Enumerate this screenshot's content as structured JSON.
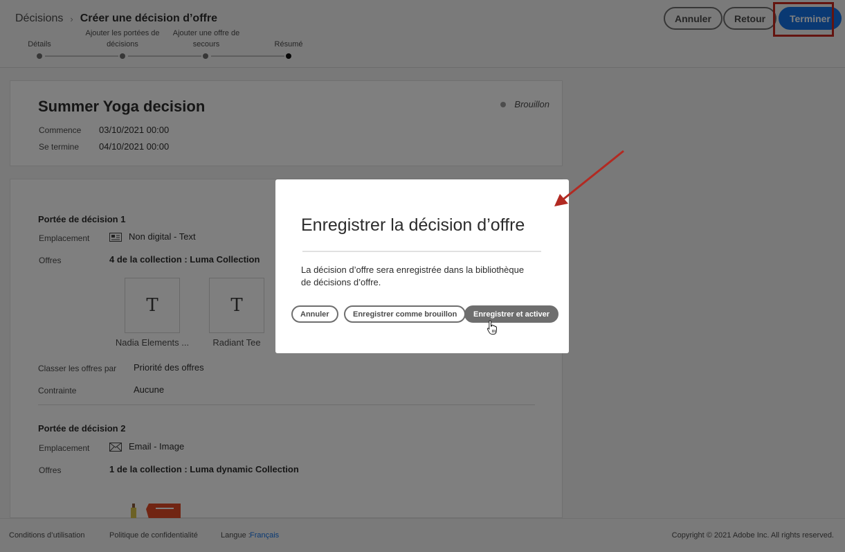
{
  "header": {
    "breadcrumb_root": "Décisions",
    "breadcrumb_sep": "›",
    "breadcrumb_current": "Créer une décision d’offre",
    "steps": [
      {
        "label": "Détails"
      },
      {
        "label": "Ajouter les portées de décisions"
      },
      {
        "label": "Ajouter une offre de secours"
      },
      {
        "label": "Résumé"
      }
    ],
    "cancel_label": "Annuler",
    "back_label": "Retour",
    "finish_label": "Terminer"
  },
  "summary": {
    "title": "Summer Yoga decision",
    "status": "Brouillon",
    "start_label": "Commence",
    "start_value": "03/10/2021 00:00",
    "end_label": "Se termine",
    "end_value": "04/10/2021 00:00"
  },
  "scope1": {
    "title": "Portée de décision 1",
    "placement_label": "Emplacement",
    "placement_value": "Non digital - Text",
    "offers_label": "Offres",
    "offers_value": "4 de la collection : Luma Collection",
    "offers": [
      {
        "glyph": "T",
        "name": "Nadia Elements ..."
      },
      {
        "glyph": "T",
        "name": "Radiant Tee"
      }
    ],
    "rank_label": "Classer les offres par",
    "rank_value": "Priorité des offres",
    "constraint_label": "Contrainte",
    "constraint_value": "Aucune"
  },
  "scope2": {
    "title": "Portée de décision 2",
    "placement_label": "Emplacement",
    "placement_value": "Email - Image",
    "offers_label": "Offres",
    "offers_value": "1 de la collection : Luma dynamic Collection"
  },
  "footer": {
    "terms": "Conditions d’utilisation",
    "privacy": "Politique de confidentialité",
    "language_label": "Langue :",
    "language_value": "Français",
    "copyright": "Copyright  ©  2021 Adobe Inc.  All rights reserved."
  },
  "modal": {
    "title": "Enregistrer la décision d’offre",
    "body": "La décision d’offre sera enregistrée dans la bibliothèque de décisions d’offre.",
    "cancel_label": "Annuler",
    "draft_label": "Enregistrer comme brouillon",
    "activate_label": "Enregistrer et activer"
  },
  "colors": {
    "accent": "#1473e6",
    "annotation": "#c8281f",
    "overlay": "rgba(0,0,0,0.5)"
  }
}
